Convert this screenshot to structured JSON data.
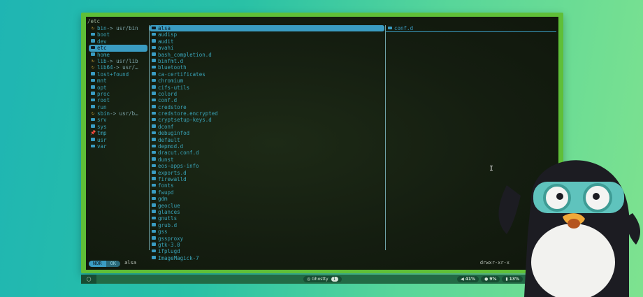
{
  "terminal": {
    "path": "/etc",
    "parent_entries": [
      {
        "name": "bin",
        "link": "-> usr/bin",
        "icon": "link"
      },
      {
        "name": "boot",
        "icon": "folder"
      },
      {
        "name": "dev",
        "icon": "folder"
      },
      {
        "name": "etc",
        "icon": "folder",
        "selected": true
      },
      {
        "name": "home",
        "icon": "folder"
      },
      {
        "name": "lib",
        "link": "-> usr/lib",
        "icon": "link"
      },
      {
        "name": "lib64",
        "link": "-> usr/…",
        "icon": "link"
      },
      {
        "name": "lost+found",
        "icon": "folder"
      },
      {
        "name": "mnt",
        "icon": "folder"
      },
      {
        "name": "opt",
        "icon": "folder"
      },
      {
        "name": "proc",
        "icon": "folder"
      },
      {
        "name": "root",
        "icon": "folder"
      },
      {
        "name": "run",
        "icon": "folder"
      },
      {
        "name": "sbin",
        "link": "-> usr/b…",
        "icon": "link"
      },
      {
        "name": "srv",
        "icon": "folder"
      },
      {
        "name": "sys",
        "icon": "folder"
      },
      {
        "name": "tmp",
        "icon": "pin"
      },
      {
        "name": "usr",
        "icon": "folder"
      },
      {
        "name": "var",
        "icon": "folder"
      }
    ],
    "current_entries": [
      "alsa",
      "audisp",
      "audit",
      "avahi",
      "bash_completion.d",
      "binfmt.d",
      "bluetooth",
      "ca-certificates",
      "chromium",
      "cifs-utils",
      "colord",
      "conf.d",
      "credstore",
      "credstore.encrypted",
      "cryptsetup-keys.d",
      "dconf",
      "debuginfod",
      "default",
      "depmod.d",
      "dracut.conf.d",
      "dunst",
      "eos-apps-info",
      "exports.d",
      "firewalld",
      "fonts",
      "fwupd",
      "gdm",
      "geoclue",
      "glances",
      "gnutls",
      "grub.d",
      "gss",
      "gssproxy",
      "gtk-3.0",
      "ifplugd",
      "ImageMagick-7"
    ],
    "preview_entries": [
      "conf.d"
    ],
    "status": {
      "mode": "NOR",
      "mode2": "OK",
      "name": "alsa",
      "perms": "drwxr-xr-x"
    }
  },
  "taskbar": {
    "left_icon": "circle-icon",
    "workspace_label": "Ghostty",
    "workspace_count": "1",
    "volume": "41%",
    "brightness": "9%",
    "battery": "13%"
  },
  "mascot": {
    "name": "penguin-mascot",
    "goggles_color": "#5fc3bd"
  }
}
